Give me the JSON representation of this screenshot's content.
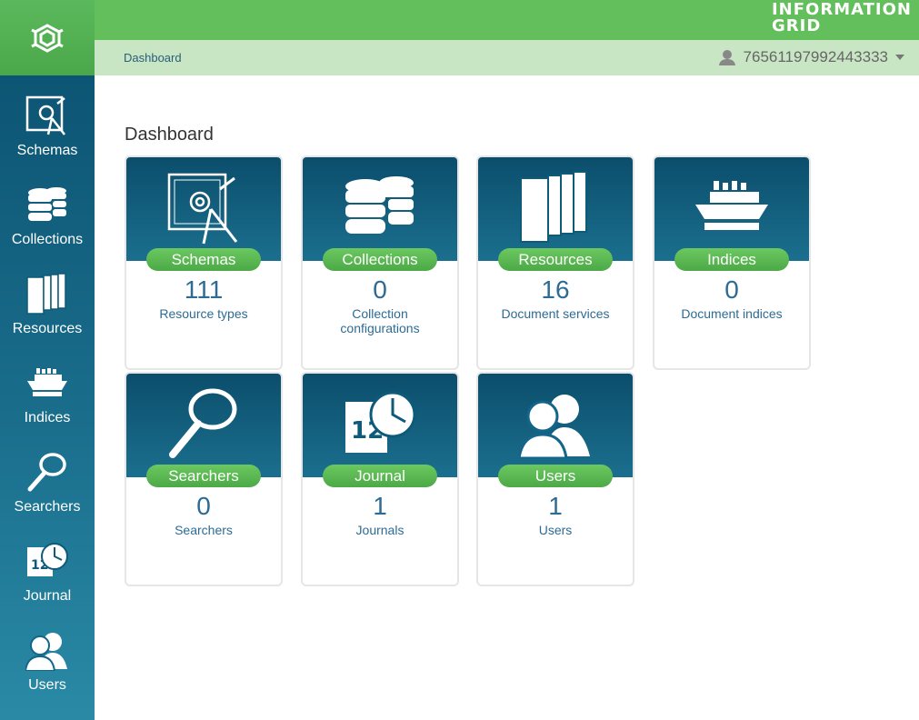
{
  "brand": {
    "line1": "INFORMATION",
    "line2": "GRID"
  },
  "breadcrumb": "Dashboard",
  "user": {
    "name": "76561197992443333"
  },
  "page_title": "Dashboard",
  "sidebar": {
    "items": [
      {
        "label": "Schemas"
      },
      {
        "label": "Collections"
      },
      {
        "label": "Resources"
      },
      {
        "label": "Indices"
      },
      {
        "label": "Searchers"
      },
      {
        "label": "Journal"
      },
      {
        "label": "Users"
      }
    ]
  },
  "cards": [
    {
      "title": "Schemas",
      "count": "111",
      "desc": "Resource types"
    },
    {
      "title": "Collections",
      "count": "0",
      "desc": "Collection configurations"
    },
    {
      "title": "Resources",
      "count": "16",
      "desc": "Document services"
    },
    {
      "title": "Indices",
      "count": "0",
      "desc": "Document indices"
    },
    {
      "title": "Searchers",
      "count": "0",
      "desc": "Searchers"
    },
    {
      "title": "Journal",
      "count": "1",
      "desc": "Journals"
    },
    {
      "title": "Users",
      "count": "1",
      "desc": "Users"
    }
  ],
  "colors": {
    "accent_green": "#62bf5c",
    "sidebar_blue": "#0a4f6e",
    "text_blue": "#2d6b94"
  }
}
